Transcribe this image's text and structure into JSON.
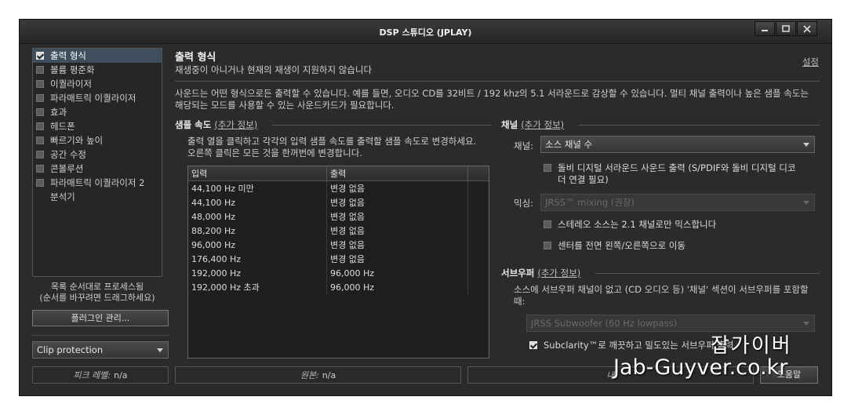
{
  "window": {
    "title": "DSP 스튜디오 (JPLAY)"
  },
  "sidebar": {
    "items": [
      {
        "label": "출력 형식",
        "checked": true,
        "selected": true,
        "has_checkbox": true
      },
      {
        "label": "볼륨 평준화",
        "checked": false,
        "selected": false,
        "has_checkbox": true
      },
      {
        "label": "이퀄라이저",
        "checked": false,
        "selected": false,
        "has_checkbox": true
      },
      {
        "label": "파라매트릭 이퀄라이저",
        "checked": false,
        "selected": false,
        "has_checkbox": true
      },
      {
        "label": "효과",
        "checked": false,
        "selected": false,
        "has_checkbox": true
      },
      {
        "label": "헤드폰",
        "checked": false,
        "selected": false,
        "has_checkbox": true
      },
      {
        "label": "빠르기와 높이",
        "checked": false,
        "selected": false,
        "has_checkbox": true
      },
      {
        "label": "공간 수정",
        "checked": false,
        "selected": false,
        "has_checkbox": true
      },
      {
        "label": "콘볼루션",
        "checked": false,
        "selected": false,
        "has_checkbox": true
      },
      {
        "label": "파라매트릭 이퀄라이저 2",
        "checked": false,
        "selected": false,
        "has_checkbox": true
      },
      {
        "label": "분석기",
        "checked": false,
        "selected": false,
        "has_checkbox": false
      }
    ],
    "hint_line1": "목록 순서대로 프로세스됨",
    "hint_line2": "(순서를 바꾸려면 드래그하세요)",
    "plugin_button": "플러그인 관리...",
    "clip_select": "Clip protection"
  },
  "status": {
    "peak_label": "피크 레벨:",
    "peak_value": "n/a",
    "source_label": "원본:",
    "source_value": "n/a",
    "right_label": "내",
    "right_button": "도움말"
  },
  "main": {
    "title": "출력 형식",
    "subtitle": "재생중이 아니거나 현재의 재생이 지원하지 않습니다",
    "settings_link": "설정",
    "description": "사운드는 어떤 형식으로든 출력할 수 있습니다. 예를 들면, 오디오 CD를 32비트 / 192 khz의 5.1 서라운드로 감상할 수 있습니다.  멀티 채널 출력이나 높은 샘플 속도는 해당되는 모드를 사용할 수 있는 사운드카드가 필요합니다.",
    "sample_rate": {
      "heading": "샘플 속도",
      "more_info": "(추가 정보)",
      "instructions": "출력 열을 클릭하고 각각의 입력 샘플 속도를 출력할 샘플 속도로 변경하세요. 오른쪽 클릭은 모든 것을 한꺼번에 변경합니다.",
      "columns": [
        "입력",
        "출력"
      ],
      "rows": [
        [
          "44,100 Hz 미만",
          "변경 없음"
        ],
        [
          "44,100 Hz",
          "변경 없음"
        ],
        [
          "48,000 Hz",
          "변경 없음"
        ],
        [
          "88,200 Hz",
          "변경 없음"
        ],
        [
          "96,000 Hz",
          "변경 없음"
        ],
        [
          "176,400 Hz",
          "변경 없음"
        ],
        [
          "192,000 Hz",
          "96,000 Hz"
        ],
        [
          "192,000 Hz 초과",
          "96,000 Hz"
        ]
      ]
    },
    "channels": {
      "heading": "채널",
      "more_info": "(추가 정보)",
      "channel_label": "채널:",
      "channel_value": "소스 채널 수",
      "dolby_label": "돌비 디지털 서라운드 사운드 출력 (S/PDIF와 돌비 디지털 디코더 연결 필요)",
      "mixing_label": "믹싱:",
      "mixing_value": "JRSS™ mixing (권장)",
      "stereo_label": "스테레오 소스는 2.1 채널로만 믹스합니다",
      "center_label": "센터를 전면 왼쪽/오른쪽으로 이동"
    },
    "subwoofer": {
      "heading": "서브우퍼",
      "more_info": "(추가 정보)",
      "description": "소스에 서브우퍼 채널이 없고 (CD 오디오 등) '채널' 섹션이 서브우퍼를 포함할 때:",
      "select_value": "JRSS Subwoofer (60 Hz lowpass)",
      "subclarity_label": "Subclarity™로 깨끗하고 밀도있는 서브우퍼 출력"
    }
  },
  "watermark": {
    "line1": "잡가이버",
    "line2": "Jab-Guyver.co.kr"
  }
}
